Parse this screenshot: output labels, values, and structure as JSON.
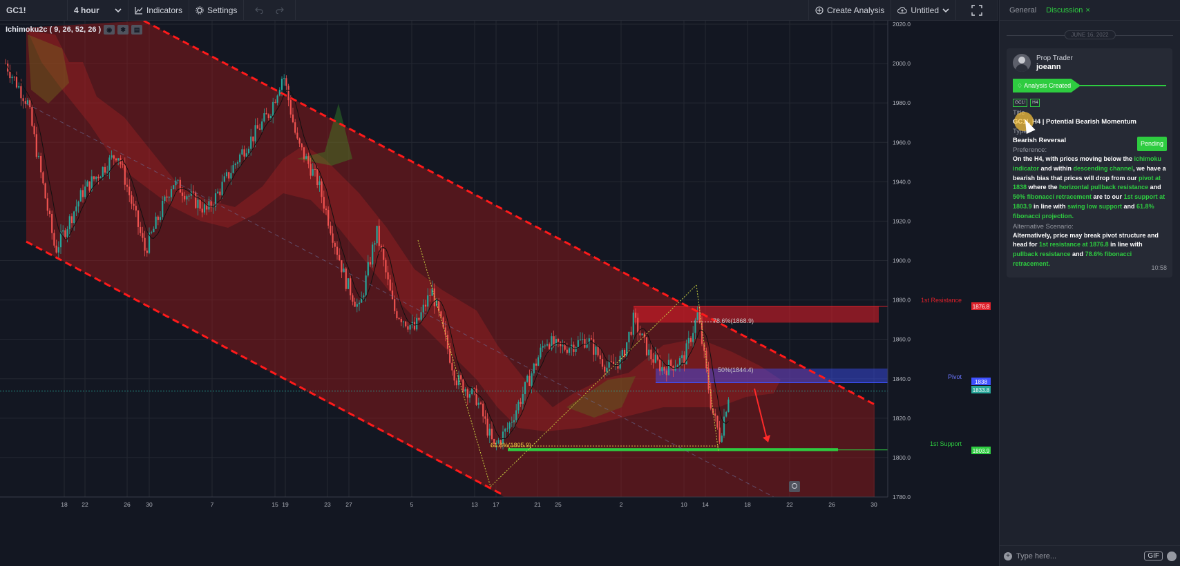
{
  "toolbar": {
    "symbol": "GC1!",
    "interval": "4 hour",
    "indicators_label": "Indicators",
    "settings_label": "Settings",
    "create_analysis_label": "Create Analysis",
    "layout_label": "Untitled"
  },
  "chart": {
    "indicator_legend": "Ichimoku2c ( 9, 26, 52, 26 )",
    "y_ticks": [
      "2020.0",
      "2000.0",
      "1980.0",
      "1960.0",
      "1940.0",
      "1920.0",
      "1900.0",
      "1880.0",
      "1860.0",
      "1840.0",
      "1820.0",
      "1800.0",
      "1780.0"
    ],
    "x_ticks": [
      "18",
      "22",
      "26",
      "30",
      "7",
      "15",
      "19",
      "23",
      "27",
      "5",
      "13",
      "17",
      "21",
      "25",
      "2",
      "10",
      "14",
      "18",
      "22",
      "26",
      "30"
    ],
    "price_badges": {
      "resistance": "1876.8",
      "pivot": "1838",
      "last": "1833.8",
      "support": "1803.9"
    },
    "labels": {
      "resistance": "1st Resistance",
      "pivot": "Pivot",
      "support": "1st Support",
      "fib_786": "78.6%(1868.9)",
      "fib_50": "50%(1844.4)",
      "fib_618": "61.8%(1805.9)"
    },
    "colors": {
      "channel": "#ff1a1a",
      "resistance_zone": "#e0202a",
      "pivot_zone": "#3f51ff",
      "support_zone": "#2ecc40",
      "up_candle": "#26a69a",
      "down_candle": "#ef5350"
    }
  },
  "panel": {
    "tabs": [
      {
        "label": "General"
      },
      {
        "label": "Discussion"
      }
    ],
    "date_separator": "JUNE 16, 2022",
    "message": {
      "author_role": "Prop Trader",
      "author_name": "joeann",
      "status": "Analysis Created",
      "chips": [
        "GC1!",
        "H4"
      ],
      "pending": "Pending",
      "title_label": "Title",
      "title_value": "GC1!, H4 | Potential Bearish Momentum",
      "type_label": "Type",
      "type_value": "Bearish Reversal",
      "preference_label": "Preference:",
      "preference_segments": [
        {
          "t": "On the H4, with prices moving below the ",
          "h": false
        },
        {
          "t": "ichimoku indicator",
          "h": true
        },
        {
          "t": " and within ",
          "h": false
        },
        {
          "t": "descending channel",
          "h": true
        },
        {
          "t": ", we have a bearish bias that prices will drop from our ",
          "h": false
        },
        {
          "t": "pivot at 1838",
          "h": true
        },
        {
          "t": " where the ",
          "h": false
        },
        {
          "t": "horizontal pullback resistance",
          "h": true
        },
        {
          "t": " and ",
          "h": false
        },
        {
          "t": "50% fibonacci retracement",
          "h": true
        },
        {
          "t": " are to our ",
          "h": false
        },
        {
          "t": "1st support  at 1803.9",
          "h": true
        },
        {
          "t": " in line with ",
          "h": false
        },
        {
          "t": "swing low support",
          "h": true
        },
        {
          "t": " and ",
          "h": false
        },
        {
          "t": "61.8% fibonacci projection.",
          "h": true
        }
      ],
      "alternative_label": "Alternative Scenario:",
      "alternative_segments": [
        {
          "t": "Alternatively, price may break pivot structure and head for ",
          "h": false
        },
        {
          "t": "1st resistance at 1876.8",
          "h": true
        },
        {
          "t": " in line with ",
          "h": false
        },
        {
          "t": "pullback resistance",
          "h": true
        },
        {
          "t": " and ",
          "h": false
        },
        {
          "t": "78.6% fibonacci retracement.",
          "h": true
        }
      ],
      "time": "10:58"
    },
    "composer_placeholder": "Type here...",
    "gif_label": "GIF"
  }
}
